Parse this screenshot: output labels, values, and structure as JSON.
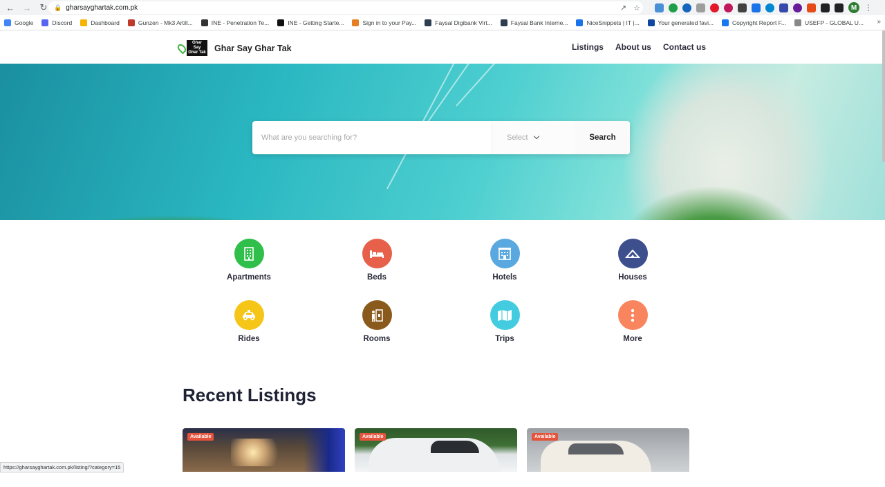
{
  "browser": {
    "url": "gharsayghartak.com.pk",
    "status_url": "https://gharsayghartak.com.pk/listing/?category=15",
    "profile_initial": "M",
    "bookmarks": [
      {
        "label": "Google",
        "color": "#4285f4"
      },
      {
        "label": "Discord",
        "color": "#5865f2"
      },
      {
        "label": "Dashboard",
        "color": "#f4b400"
      },
      {
        "label": "Gunzen - Mk3 Artill...",
        "color": "#c0392b"
      },
      {
        "label": "INE - Penetration Te...",
        "color": "#333333"
      },
      {
        "label": "INE - Getting Starte...",
        "color": "#111111"
      },
      {
        "label": "Sign in to your Pay...",
        "color": "#e67e22"
      },
      {
        "label": "Faysal Digibank Virt...",
        "color": "#2c3e50"
      },
      {
        "label": "Faysal Bank Interne...",
        "color": "#2c3e50"
      },
      {
        "label": "NiceSnippets | IT |...",
        "color": "#1a73e8"
      },
      {
        "label": "Your generated favi...",
        "color": "#0d47a1"
      },
      {
        "label": "Copyright Report F...",
        "color": "#1877f2"
      },
      {
        "label": "USEFP - GLOBAL U...",
        "color": "#888888"
      }
    ]
  },
  "header": {
    "brand": "Ghar Say Ghar Tak",
    "logo_text": "Ghar Say Ghar Tak",
    "nav": [
      {
        "label": "Listings"
      },
      {
        "label": "About us"
      },
      {
        "label": "Contact us"
      }
    ]
  },
  "search": {
    "placeholder": "What are you searching for?",
    "select_label": "Select",
    "button_label": "Search"
  },
  "categories": [
    {
      "label": "Apartments",
      "icon": "building-icon",
      "color": "#2fbf4a"
    },
    {
      "label": "Beds",
      "icon": "bed-icon",
      "color": "#e7614a"
    },
    {
      "label": "Hotels",
      "icon": "hotel-icon",
      "color": "#5aa8e0"
    },
    {
      "label": "Houses",
      "icon": "house-icon",
      "color": "#3d4f8c"
    },
    {
      "label": "Rides",
      "icon": "car-icon",
      "color": "#f5c518"
    },
    {
      "label": "Rooms",
      "icon": "rooms-icon",
      "color": "#8a5a1c"
    },
    {
      "label": "Trips",
      "icon": "map-icon",
      "color": "#43cce0"
    },
    {
      "label": "More",
      "icon": "more-icon",
      "color": "#f9855f"
    }
  ],
  "recent": {
    "title": "Recent Listings",
    "cards": [
      {
        "badge": "Available"
      },
      {
        "badge": "Available"
      },
      {
        "badge": "Available"
      }
    ]
  }
}
